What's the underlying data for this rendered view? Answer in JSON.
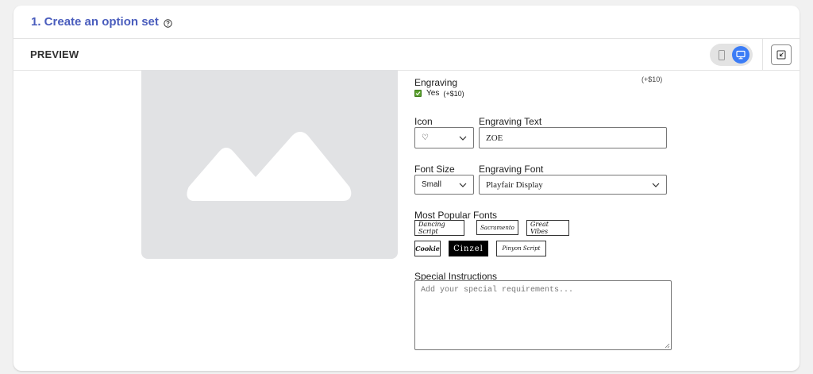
{
  "header": {
    "title": "1. Create an option set",
    "help_icon": "help-circle-icon"
  },
  "preview": {
    "label": "PREVIEW",
    "mobile_icon": "mobile-icon",
    "desktop_icon": "desktop-icon",
    "expand_icon": "collapse-icon",
    "active_view": "desktop"
  },
  "form": {
    "engraving": {
      "label": "Engraving",
      "price_note": "(+$10)",
      "option_label": "Yes",
      "option_price": "(+$10)",
      "checked": true
    },
    "icon": {
      "label": "Icon",
      "value": "♡"
    },
    "engraving_text": {
      "label": "Engraving Text",
      "value": "ZOE"
    },
    "font_size": {
      "label": "Font Size",
      "value": "Small"
    },
    "engraving_font": {
      "label": "Engraving Font",
      "value": "Playfair Display"
    },
    "popular_fonts": {
      "label": "Most Popular Fonts",
      "items": [
        "Dancing Script",
        "Sacramento",
        "Great Vibes",
        "Cookie",
        "Cinzel",
        "Pinyon Script"
      ],
      "selected": "Cinzel"
    },
    "special_instructions": {
      "label": "Special Instructions",
      "placeholder": "Add your special requirements..."
    }
  },
  "colors": {
    "title": "#4a5dbd",
    "toggle_active": "#3b7cf6",
    "checkbox": "#5aa02c",
    "placeholder_bg": "#e1e2e4"
  }
}
